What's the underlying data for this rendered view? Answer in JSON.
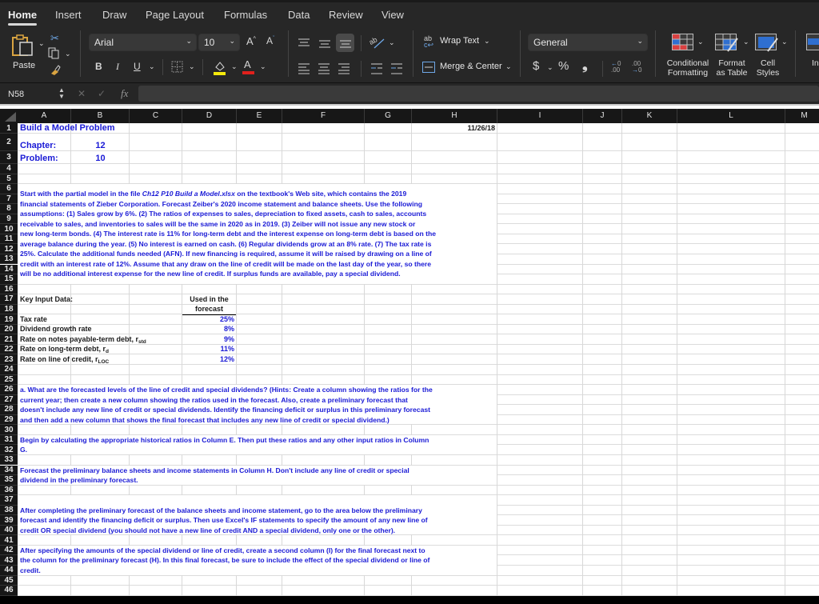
{
  "ribbon": {
    "tabs": [
      "Home",
      "Insert",
      "Draw",
      "Page Layout",
      "Formulas",
      "Data",
      "Review",
      "View"
    ],
    "active_tab": "Home",
    "paste_label": "Paste",
    "font_name": "Arial",
    "font_size": "10",
    "wrap_text_label": "Wrap Text",
    "merge_center_label": "Merge & Center",
    "number_format": "General",
    "conditional_formatting_label": [
      "Conditional",
      "Formatting"
    ],
    "format_as_table_label": [
      "Format",
      "as Table"
    ],
    "cell_styles_label": [
      "Cell",
      "Styles"
    ],
    "insert_label": "In",
    "bold": "B",
    "italic": "I",
    "underline": "U",
    "font_color_letter": "A",
    "grow_font": "A",
    "shrink_font": "A",
    "currency_symbol": "$",
    "percent_symbol": "%",
    "comma_symbol": "❟",
    "fill_color": "#f5e90c",
    "font_color": "#e0201c"
  },
  "formula_bar": {
    "name_box": "N58",
    "cancel_icon": "✕",
    "confirm_icon": "✓",
    "fx_label": "fx",
    "formula": ""
  },
  "columns": [
    "A",
    "B",
    "C",
    "D",
    "E",
    "F",
    "G",
    "H",
    "I",
    "J",
    "K",
    "L",
    "M"
  ],
  "rows": [
    "1",
    "2",
    "3",
    "4",
    "5",
    "6",
    "7",
    "8",
    "9",
    "10",
    "11",
    "12",
    "13",
    "14",
    "15",
    "16",
    "17",
    "18",
    "19",
    "20",
    "21",
    "22",
    "23",
    "24",
    "25",
    "26",
    "27",
    "28",
    "29",
    "30",
    "31",
    "32",
    "33",
    "34",
    "35",
    "36",
    "37",
    "38",
    "39",
    "40",
    "41",
    "42",
    "43",
    "44",
    "45",
    "46"
  ],
  "sheet": {
    "title": "Build a Model Problem",
    "date": "11/26/18",
    "chapter_label": "Chapter:",
    "chapter_value": "12",
    "problem_label": "Problem:",
    "problem_value": "10",
    "intro_lines": [
      "Start with the partial model in the file ",
      "financial statements of Zieber Corporation. Forecast Zeiber's 2020 income statement and balance sheets. Use the following",
      "assumptions: (1) Sales grow by 6%. (2) The ratios of expenses to sales, depreciation to fixed assets, cash to sales, accounts",
      "receivable to sales, and inventories to sales will be the same in 2020 as in 2019. (3) Zeiber will not issue any new stock or",
      "new long-term bonds. (4) The interest rate is 11% for long-term debt and the interest expense on long-term debt is based on the",
      "average balance during the year. (5) No interest is earned on cash. (6) Regular dividends grow at an 8% rate. (7) The tax rate is",
      "25%. Calculate the additional funds needed (AFN). If new financing is required, assume it will be raised by drawing on a line of",
      "credit with an interest rate of 12%. Assume that any draw on the line of credit will be made on the last day of the year, so there",
      "will be no additional interest expense for the new line of credit. If surplus funds are available, pay a special dividend."
    ],
    "intro_file_name": "Ch12 P10 Build a Model.xlsx",
    "intro_line1_tail": " on the textbook's Web site, which contains the 2019",
    "key_input_label": "Key Input Data:",
    "used_header_1": "Used in the",
    "used_header_2": "forecast",
    "inputs": [
      {
        "label": "Tax rate",
        "sub": "",
        "value": "25%"
      },
      {
        "label": "Dividend growth rate",
        "sub": "",
        "value": "8%"
      },
      {
        "label": "Rate on notes payable-term debt, r",
        "sub": "std",
        "value": "9%"
      },
      {
        "label": "Rate on long-term debt, r",
        "sub": "d",
        "value": "11%"
      },
      {
        "label": "Rate on line of credit, r",
        "sub": "LOC",
        "value": "12%"
      }
    ],
    "question_a_lines": [
      "a. What are the forecasted levels of the line of credit and special dividends? (Hints: Create a column showing the ratios for the",
      "current year; then create a new column showing the ratios used in the forecast. Also, create a preliminary forecast that",
      "doesn't include any new line of credit or special dividends. Identify the financing deficit or surplus in this preliminary forecast",
      "and then add a new column that shows the final forecast that includes any new line of credit or special dividend.)"
    ],
    "step1_lines": [
      "Begin by calculating the appropriate historical ratios in Column E. Then put these ratios and any other input ratios in Column",
      "G."
    ],
    "step2_lines": [
      "Forecast the preliminary balance sheets and income statements in Column H. Don't include any line of credit or special",
      "dividend in the preliminary forecast."
    ],
    "step3_lines": [
      "After completing the preliminary forecast of the balance sheets and income statement, go to the area below the preliminary",
      "forecast and identify the financing deficit or surplus. Then use Excel's IF statements to specify the amount of any new line of",
      "credit OR special dividend (you should not have a new line of credit AND a special dividend, only one or the other)."
    ],
    "step4_lines": [
      "After specifying the amounts of the special dividend or line of credit, create a second column (I) for the final forecast next to",
      "the column for the preliminary forecast (H). In this final forecast, be sure to include the effect of the special dividend or line of",
      "credit."
    ]
  }
}
